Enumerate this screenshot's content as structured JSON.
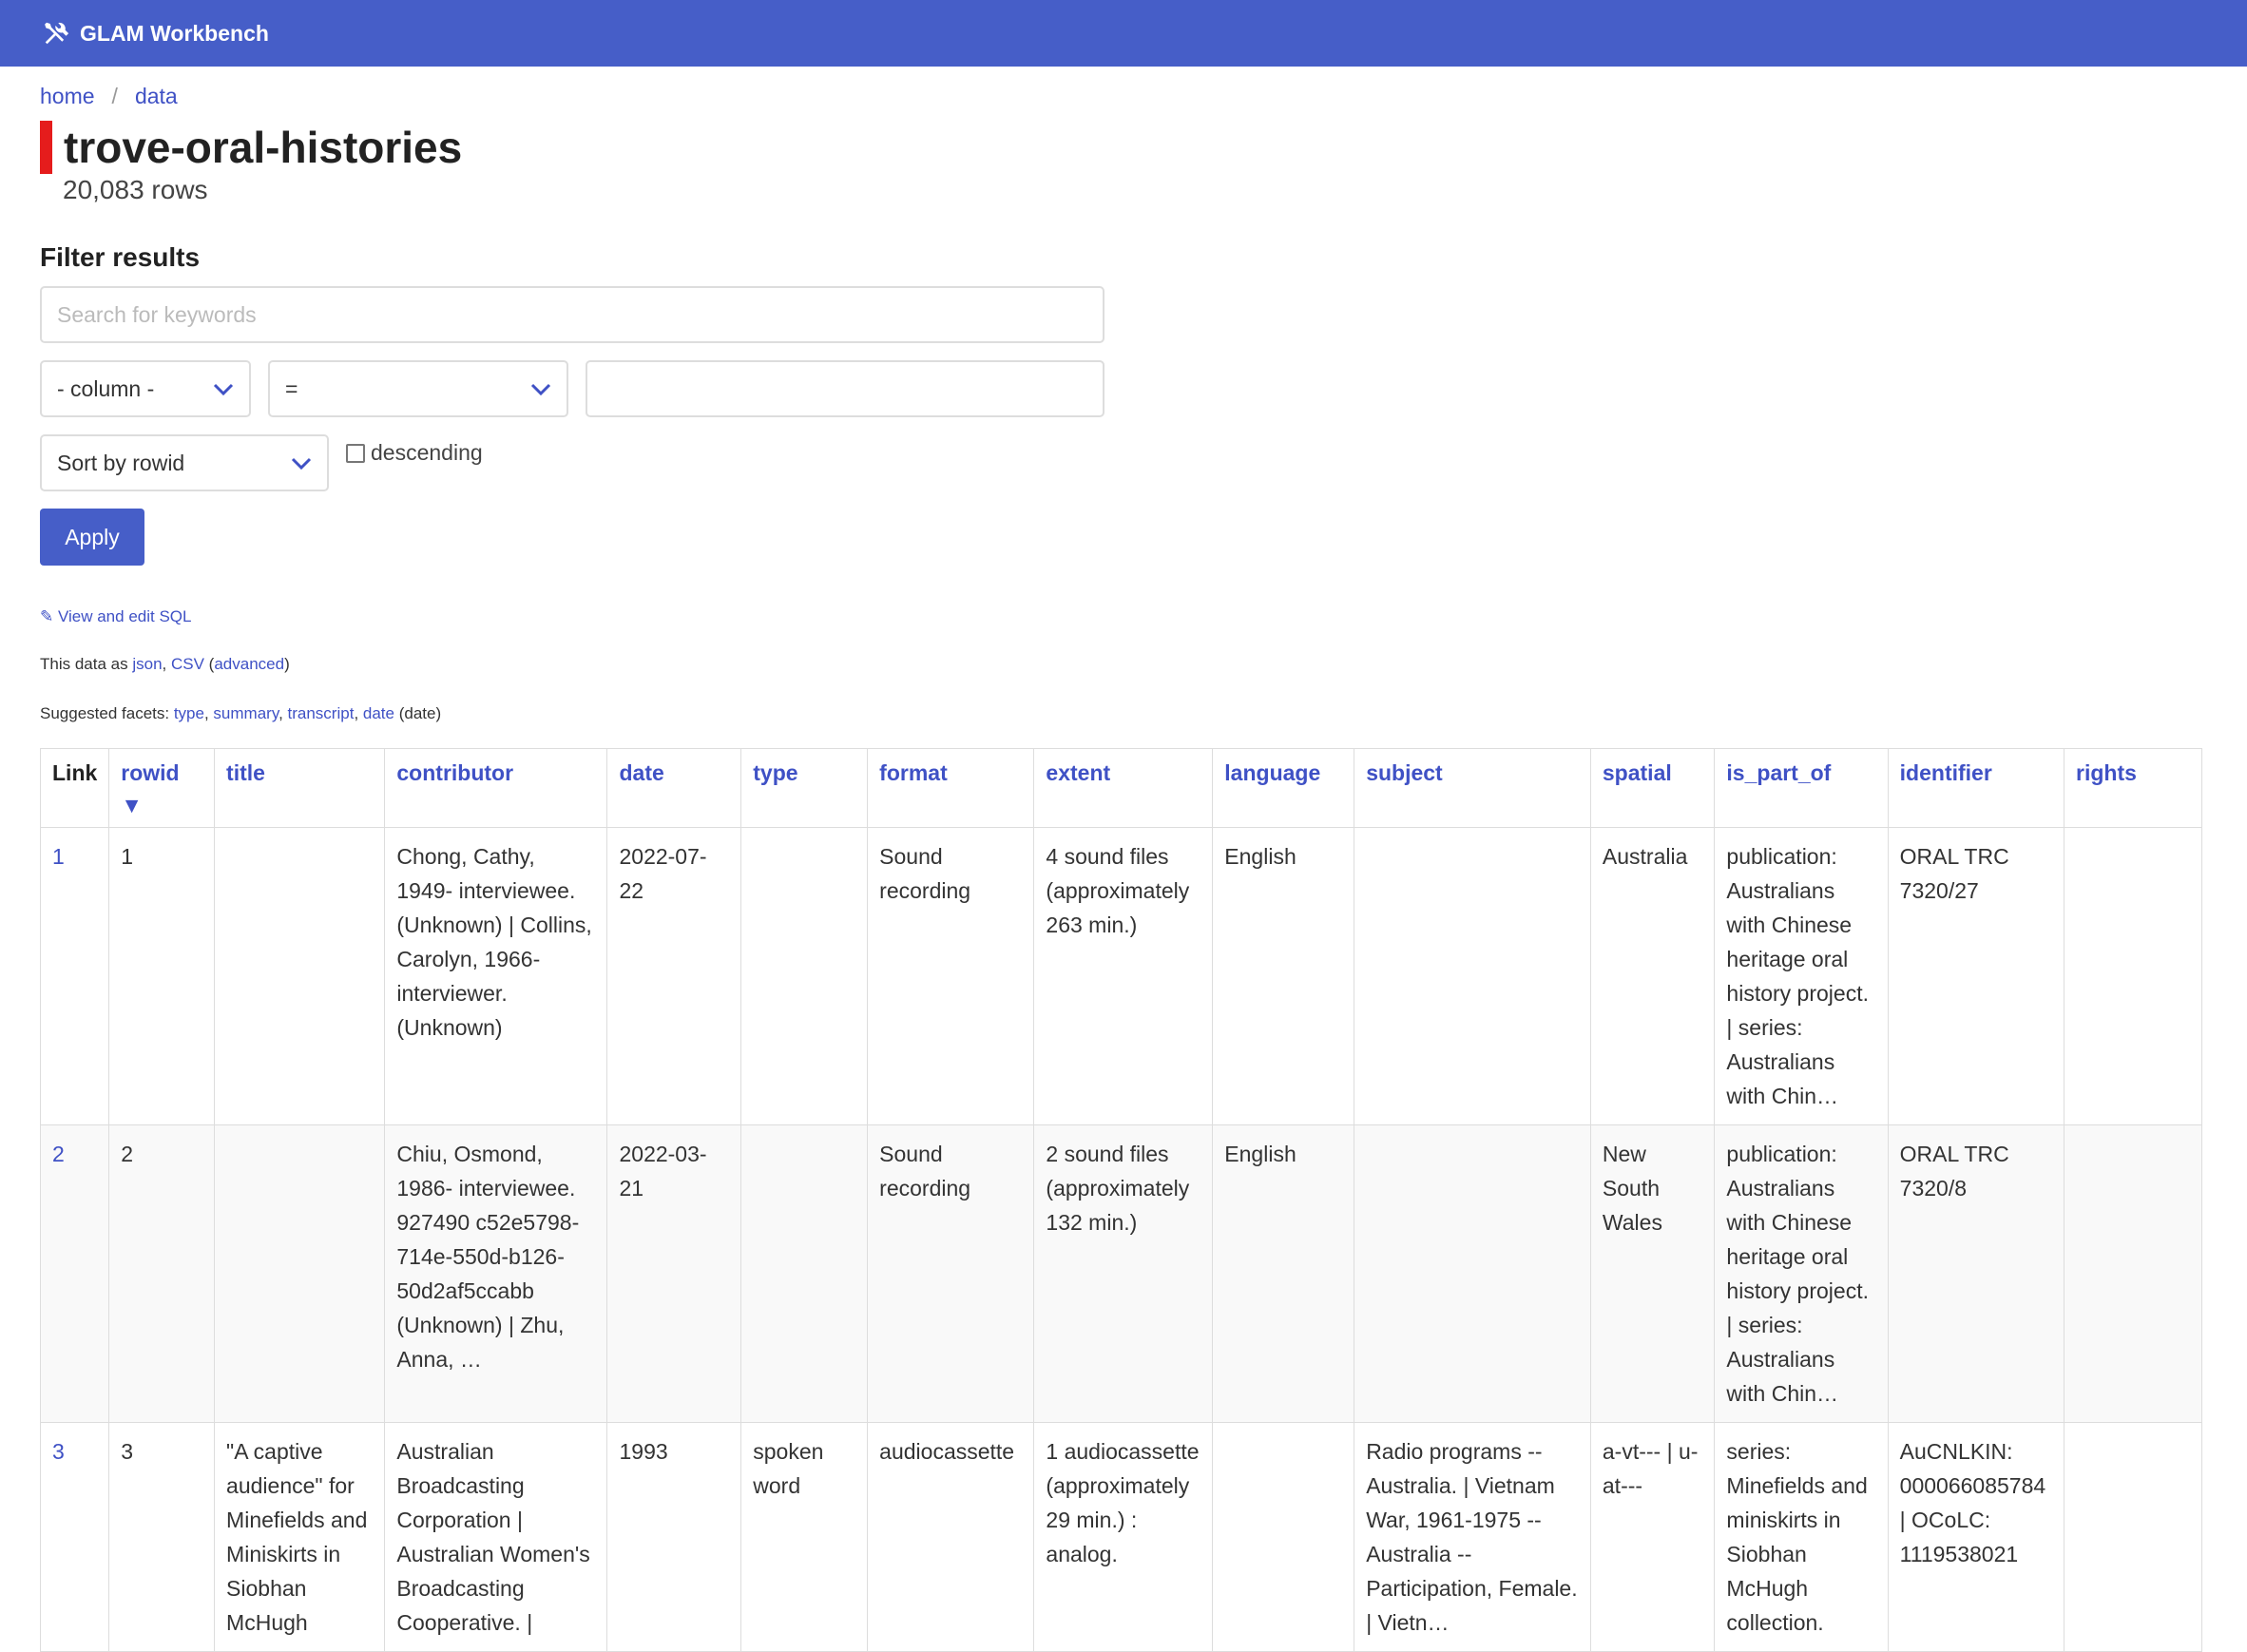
{
  "app": {
    "name": "GLAM Workbench"
  },
  "breadcrumb": {
    "home": "home",
    "data": "data"
  },
  "page": {
    "title": "trove-oral-histories",
    "rows_label": "20,083 rows"
  },
  "filter": {
    "heading": "Filter results",
    "search_placeholder": "Search for keywords",
    "column_select": "- column -",
    "operator_select": "=",
    "value": "",
    "sort_select": "Sort by rowid",
    "descending_label": "descending",
    "apply_label": "Apply"
  },
  "links": {
    "view_sql": "✎ View and edit SQL",
    "data_as_prefix": "This data as",
    "json": "json",
    "csv": "CSV",
    "advanced": "advanced",
    "facets_prefix": "Suggested facets:",
    "facet_type": "type",
    "facet_summary": "summary",
    "facet_transcript": "transcript",
    "facet_date": "date",
    "facet_date_suffix": "(date)"
  },
  "table": {
    "headers": {
      "link": "Link",
      "rowid": "rowid ▼",
      "title": "title",
      "contributor": "contributor",
      "date": "date",
      "type": "type",
      "format": "format",
      "extent": "extent",
      "language": "language",
      "subject": "subject",
      "spatial": "spatial",
      "is_part_of": "is_part_of",
      "identifier": "identifier",
      "rights": "rights"
    },
    "rows": [
      {
        "link": "1",
        "rowid": "1",
        "title": "",
        "contributor": "Chong, Cathy, 1949- interviewee. (Unknown) | Collins, Carolyn, 1966- interviewer. (Unknown)",
        "date": "2022-07-22",
        "type": "",
        "format": "Sound recording",
        "extent": "4 sound files (approximately 263 min.)",
        "language": "English",
        "subject": "",
        "spatial": "Australia",
        "is_part_of": "publication: Australians with Chinese heritage oral history project. | series: Australians with Chin…",
        "identifier": "ORAL TRC 7320/27",
        "rights": ""
      },
      {
        "link": "2",
        "rowid": "2",
        "title": "",
        "contributor": "Chiu, Osmond, 1986- interviewee. 927490 c52e5798-714e-550d-b126-50d2af5ccabb (Unknown) | Zhu, Anna, …",
        "date": "2022-03-21",
        "type": "",
        "format": "Sound recording",
        "extent": "2 sound files (approximately 132 min.)",
        "language": "English",
        "subject": "",
        "spatial": "New South Wales",
        "is_part_of": "publication: Australians with Chinese heritage oral history project. | series: Australians with Chin…",
        "identifier": "ORAL TRC 7320/8",
        "rights": ""
      },
      {
        "link": "3",
        "rowid": "3",
        "title": "\"A captive audience\" for Minefields and Miniskirts in Siobhan McHugh",
        "contributor": "Australian Broadcasting Corporation | Australian Women's Broadcasting Cooperative. |",
        "date": "1993",
        "type": "spoken word",
        "format": "audiocassette",
        "extent": "1 audiocassette (approximately 29 min.) : analog.",
        "language": "",
        "subject": "Radio programs -- Australia. | Vietnam War, 1961-1975 -- Australia -- Participation, Female. | Vietn…",
        "spatial": "a-vt--- | u-at---",
        "is_part_of": "series: Minefields and miniskirts in Siobhan McHugh collection.",
        "identifier": "AuCNLKIN: 000066085784 | OCoLC: 1119538021",
        "rights": ""
      }
    ]
  }
}
